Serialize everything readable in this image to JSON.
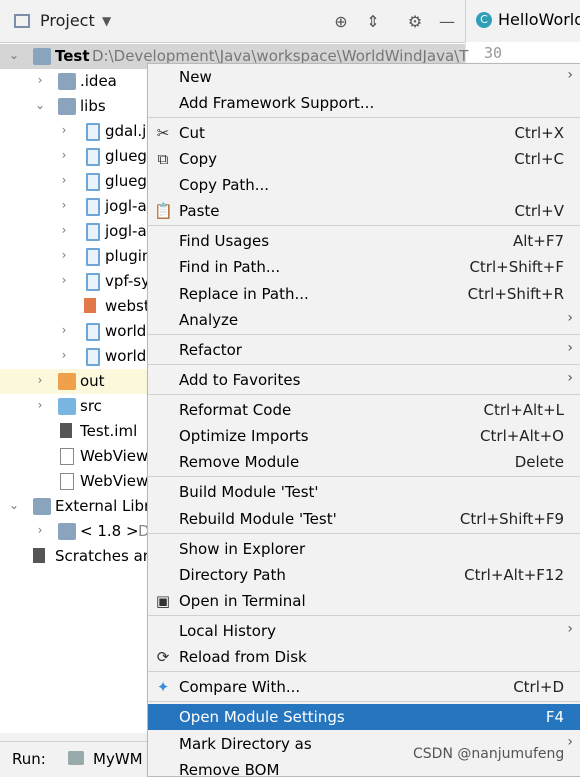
{
  "toolbar": {
    "project_label": "Project",
    "dropdown_icon": "chevron-down-icon",
    "icons": [
      "target-icon",
      "collapse-icon",
      "gear-icon",
      "minimize-icon"
    ]
  },
  "editor": {
    "tab_label": "HelloWorld",
    "line_number": "30"
  },
  "tree": {
    "root_name": "Test",
    "root_path": "D:\\Development\\Java\\workspace\\WorldWindJava\\T",
    "items": [
      {
        "label": ".idea"
      },
      {
        "label": "libs"
      },
      {
        "label": "gdal.ja"
      },
      {
        "label": "glueg"
      },
      {
        "label": "glueg"
      },
      {
        "label": "jogl-a"
      },
      {
        "label": "jogl-a"
      },
      {
        "label": "plugin"
      },
      {
        "label": "vpf-sy"
      },
      {
        "label": "webst"
      },
      {
        "label": "world"
      },
      {
        "label": "world"
      },
      {
        "label": "out"
      },
      {
        "label": "src"
      },
      {
        "label": "Test.iml"
      },
      {
        "label": "WebView"
      },
      {
        "label": "WebView"
      },
      {
        "label": "External Libra"
      },
      {
        "label": "< 1.8 >"
      },
      {
        "label": "Scratches an"
      }
    ],
    "jdk_suffix": "D"
  },
  "runbar": {
    "run_label": "Run:",
    "config_label": "MyWM"
  },
  "menu": {
    "items": [
      {
        "label": "New",
        "shortcut": "",
        "submenu": true,
        "icon": ""
      },
      {
        "label": "Add Framework Support...",
        "shortcut": "",
        "submenu": false,
        "icon": ""
      },
      {
        "label": "Cut",
        "shortcut": "Ctrl+X",
        "submenu": false,
        "icon": "scissors-icon"
      },
      {
        "label": "Copy",
        "shortcut": "Ctrl+C",
        "submenu": false,
        "icon": "copy-icon"
      },
      {
        "label": "Copy Path...",
        "shortcut": "",
        "submenu": false,
        "icon": ""
      },
      {
        "label": "Paste",
        "shortcut": "Ctrl+V",
        "submenu": false,
        "icon": "clipboard-icon"
      },
      {
        "label": "Find Usages",
        "shortcut": "Alt+F7",
        "submenu": false,
        "icon": ""
      },
      {
        "label": "Find in Path...",
        "shortcut": "Ctrl+Shift+F",
        "submenu": false,
        "icon": ""
      },
      {
        "label": "Replace in Path...",
        "shortcut": "Ctrl+Shift+R",
        "submenu": false,
        "icon": ""
      },
      {
        "label": "Analyze",
        "shortcut": "",
        "submenu": true,
        "icon": ""
      },
      {
        "label": "Refactor",
        "shortcut": "",
        "submenu": true,
        "icon": ""
      },
      {
        "label": "Add to Favorites",
        "shortcut": "",
        "submenu": true,
        "icon": ""
      },
      {
        "label": "Reformat Code",
        "shortcut": "Ctrl+Alt+L",
        "submenu": false,
        "icon": ""
      },
      {
        "label": "Optimize Imports",
        "shortcut": "Ctrl+Alt+O",
        "submenu": false,
        "icon": ""
      },
      {
        "label": "Remove Module",
        "shortcut": "Delete",
        "submenu": false,
        "icon": ""
      },
      {
        "label": "Build Module 'Test'",
        "shortcut": "",
        "submenu": false,
        "icon": ""
      },
      {
        "label": "Rebuild Module 'Test'",
        "shortcut": "Ctrl+Shift+F9",
        "submenu": false,
        "icon": ""
      },
      {
        "label": "Show in Explorer",
        "shortcut": "",
        "submenu": false,
        "icon": ""
      },
      {
        "label": "Directory Path",
        "shortcut": "Ctrl+Alt+F12",
        "submenu": false,
        "icon": ""
      },
      {
        "label": "Open in Terminal",
        "shortcut": "",
        "submenu": false,
        "icon": "terminal-icon"
      },
      {
        "label": "Local History",
        "shortcut": "",
        "submenu": true,
        "icon": ""
      },
      {
        "label": "Reload from Disk",
        "shortcut": "",
        "submenu": false,
        "icon": "reload-icon"
      },
      {
        "label": "Compare With...",
        "shortcut": "Ctrl+D",
        "submenu": false,
        "icon": "compare-icon"
      },
      {
        "label": "Open Module Settings",
        "shortcut": "F4",
        "submenu": false,
        "icon": "",
        "selected": true
      },
      {
        "label": "Mark Directory as",
        "shortcut": "",
        "submenu": true,
        "icon": ""
      },
      {
        "label": "Remove BOM",
        "shortcut": "",
        "submenu": false,
        "icon": ""
      }
    ]
  },
  "watermark": "CSDN @nanjumufeng",
  "colors": {
    "selection": "#2675bf",
    "menu_bg": "#f2f2f2",
    "tree_bg": "#ffffff",
    "highlight_row": "#fcf8dc"
  }
}
